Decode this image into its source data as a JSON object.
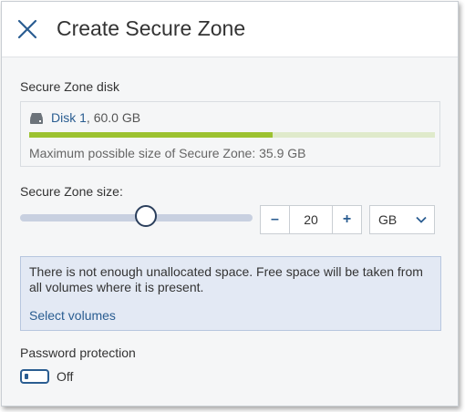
{
  "dialog": {
    "title": "Create Secure Zone",
    "close_icon": "close-icon"
  },
  "disk_section": {
    "label": "Secure Zone disk",
    "disk_icon": "hard-drive-icon",
    "disk_name": "Disk 1",
    "separator": ",",
    "disk_size": "60.0 GB",
    "used_fraction": 0.6,
    "max_size_text": "Maximum possible size of Secure Zone: 35.9 GB",
    "bar_fill_color": "#9cc230",
    "bar_track_color": "#dfeacb"
  },
  "size_section": {
    "label": "Secure Zone size:",
    "slider_fraction": 0.54,
    "minus_label": "–",
    "plus_label": "+",
    "value": "20",
    "unit": "GB",
    "unit_icon": "chevron-down-icon"
  },
  "info": {
    "message": "There is not enough unallocated space. Free space will be taken from all volumes where it is present.",
    "link": "Select volumes"
  },
  "password": {
    "label": "Password protection",
    "toggle_state": "Off"
  },
  "colors": {
    "accent": "#2a5d91",
    "info_bg": "#e3e9f4"
  }
}
